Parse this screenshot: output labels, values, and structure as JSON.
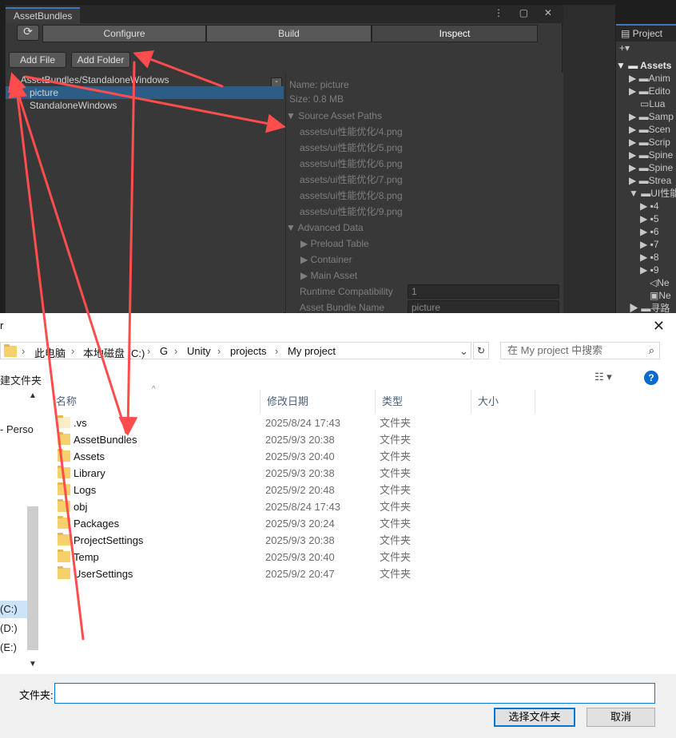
{
  "unity": {
    "window_tab": "AssetBundles",
    "segments": [
      "Configure",
      "Build",
      "Inspect"
    ],
    "add_file": "Add File",
    "add_folder": "Add Folder",
    "tree": {
      "root": "AssetBundles/StandaloneWindows",
      "items": [
        "picture",
        "StandaloneWindows"
      ],
      "minus": "-"
    },
    "inspector": {
      "name": "Name: picture",
      "size": "Size: 0.8 MB",
      "source_header": "Source Asset Paths",
      "paths": [
        "assets/ui性能优化/4.png",
        "assets/ui性能优化/5.png",
        "assets/ui性能优化/6.png",
        "assets/ui性能优化/7.png",
        "assets/ui性能优化/8.png",
        "assets/ui性能优化/9.png"
      ],
      "advanced_header": "Advanced Data",
      "advanced_items": [
        "Preload Table",
        "Container",
        "Main Asset"
      ],
      "runtime_label": "Runtime Compatibility",
      "runtime_value": "1",
      "bundle_label": "Asset Bundle Name",
      "bundle_value": "picture"
    },
    "project": {
      "tab": "Project",
      "add": "+▾",
      "items": [
        "Assets",
        "Anim",
        "Edito",
        "Lua",
        "Samp",
        "Scen",
        "Scrip",
        "Spine",
        "Spine",
        "Strea",
        "UI性能",
        "4",
        "5",
        "6",
        "7",
        "8",
        "9",
        "Ne",
        "Ne",
        "寻路"
      ]
    }
  },
  "dialog": {
    "title_char": "r",
    "breadcrumbs": [
      "此电脑",
      "本地磁盘 (C:)",
      "G",
      "Unity",
      "projects",
      "My project"
    ],
    "search_placeholder": "在 My project 中搜索",
    "new_folder": "建文件夹",
    "columns": [
      "名称",
      "修改日期",
      "类型",
      "大小"
    ],
    "rows": [
      {
        "name": ".vs",
        "date": "2025/8/24 17:43",
        "type": "文件夹"
      },
      {
        "name": "AssetBundles",
        "date": "2025/9/3 20:38",
        "type": "文件夹"
      },
      {
        "name": "Assets",
        "date": "2025/9/3 20:40",
        "type": "文件夹"
      },
      {
        "name": "Library",
        "date": "2025/9/3 20:38",
        "type": "文件夹"
      },
      {
        "name": "Logs",
        "date": "2025/9/2 20:48",
        "type": "文件夹"
      },
      {
        "name": "obj",
        "date": "2025/8/24 17:43",
        "type": "文件夹"
      },
      {
        "name": "Packages",
        "date": "2025/9/3 20:24",
        "type": "文件夹"
      },
      {
        "name": "ProjectSettings",
        "date": "2025/9/3 20:38",
        "type": "文件夹"
      },
      {
        "name": "Temp",
        "date": "2025/9/3 20:40",
        "type": "文件夹"
      },
      {
        "name": "UserSettings",
        "date": "2025/9/2 20:47",
        "type": "文件夹"
      }
    ],
    "nav_items": [
      "- Perso",
      "(C:)",
      "(D:)",
      "(E:)"
    ],
    "folder_label": "文件夹:",
    "folder_value": "",
    "select_button": "选择文件夹",
    "cancel_button": "取消"
  },
  "colors": {
    "annotation_arrow": "#ff4d4d",
    "selection": "#2c5d87",
    "accent": "#0078d7"
  }
}
